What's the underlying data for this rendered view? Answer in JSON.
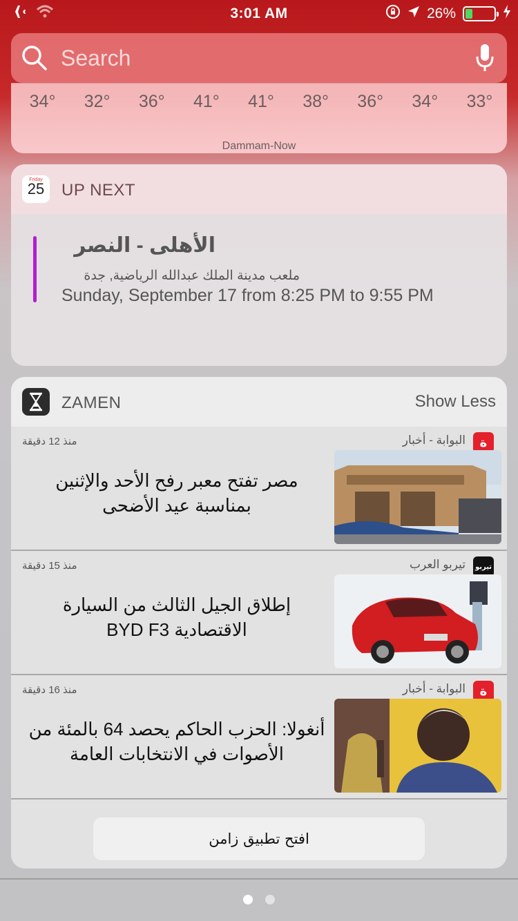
{
  "status_bar": {
    "time": "3:01 AM",
    "battery_text": "26%",
    "battery_level": 0.26,
    "icons": [
      "airplane-icon",
      "wifi-icon",
      "orientation-lock-icon",
      "location-icon",
      "battery-icon",
      "charging-icon"
    ]
  },
  "search": {
    "placeholder": "Search"
  },
  "weather": {
    "temps": [
      "34°",
      "32°",
      "36°",
      "41°",
      "41°",
      "38°",
      "36°",
      "34°",
      "33°"
    ],
    "location": "Dammam-Now"
  },
  "upnext": {
    "title": "UP NEXT",
    "calendar_day": "Friday",
    "calendar_date": "25",
    "event_title": "الأهلى - النصر",
    "event_location": "ملعب مدينة الملك عبدالله الرياضية, جدة",
    "event_time": "Sunday, September 17 from 8:25 PM to 9:55 PM",
    "accent_color": "#b020d0"
  },
  "zamen": {
    "title": "ZAMEN",
    "show_less": "Show Less",
    "news": [
      {
        "source": "البوابة - أخبار",
        "logo": "ة",
        "time": "منذ 12 دقيقة",
        "headline": "مصر تفتح معبر رفح الأحد والإثنين بمناسبة عيد الأضحى"
      },
      {
        "source": "تيربو العرب",
        "logo": "تيربو",
        "time": "منذ 15 دقيقة",
        "headline": "إطلاق الجيل الثالث من السيارة الاقتصادية BYD F3"
      },
      {
        "source": "البوابة - أخبار",
        "logo": "ة",
        "time": "منذ 16 دقيقة",
        "headline": "أنغولا: الحزب الحاكم يحصد 64 بالمئة من الأصوات في الانتخابات العامة"
      }
    ],
    "open_app": "افتح تطبيق زامن"
  },
  "page_dots": {
    "count": 2,
    "active": 1
  }
}
